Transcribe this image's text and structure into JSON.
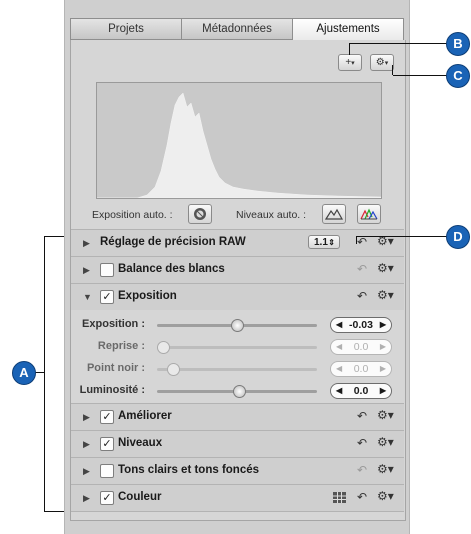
{
  "tabs": [
    "Projets",
    "Métadonnées",
    "Ajustements"
  ],
  "toolbar": {
    "add_label": "+",
    "gear_label": "⚙"
  },
  "auto": {
    "exposure_label": "Exposition auto. :",
    "levels_label": "Niveaux auto. :"
  },
  "raw_row": {
    "title": "Réglage de précision RAW",
    "version": "1.1"
  },
  "rows": {
    "balance": "Balance des blancs",
    "exposition": "Exposition",
    "ameliorer": "Améliorer",
    "niveaux": "Niveaux",
    "tons": "Tons clairs et tons foncés",
    "couleur": "Couleur"
  },
  "sliders": [
    {
      "label": "Exposition :",
      "value": "-0.03",
      "enabled": true
    },
    {
      "label": "Reprise :",
      "value": "0.0",
      "enabled": false
    },
    {
      "label": "Point noir :",
      "value": "0.0",
      "enabled": false
    },
    {
      "label": "Luminosité :",
      "value": "0.0",
      "enabled": true
    }
  ],
  "callouts": {
    "a": "A",
    "b": "B",
    "c": "C",
    "d": "D"
  },
  "icons": {
    "reset": "↶",
    "gear": "⚙▾",
    "triangle_right": "▶",
    "triangle_down": "▼",
    "check": "✓",
    "arrow_left": "◀",
    "arrow_right": "▶"
  }
}
